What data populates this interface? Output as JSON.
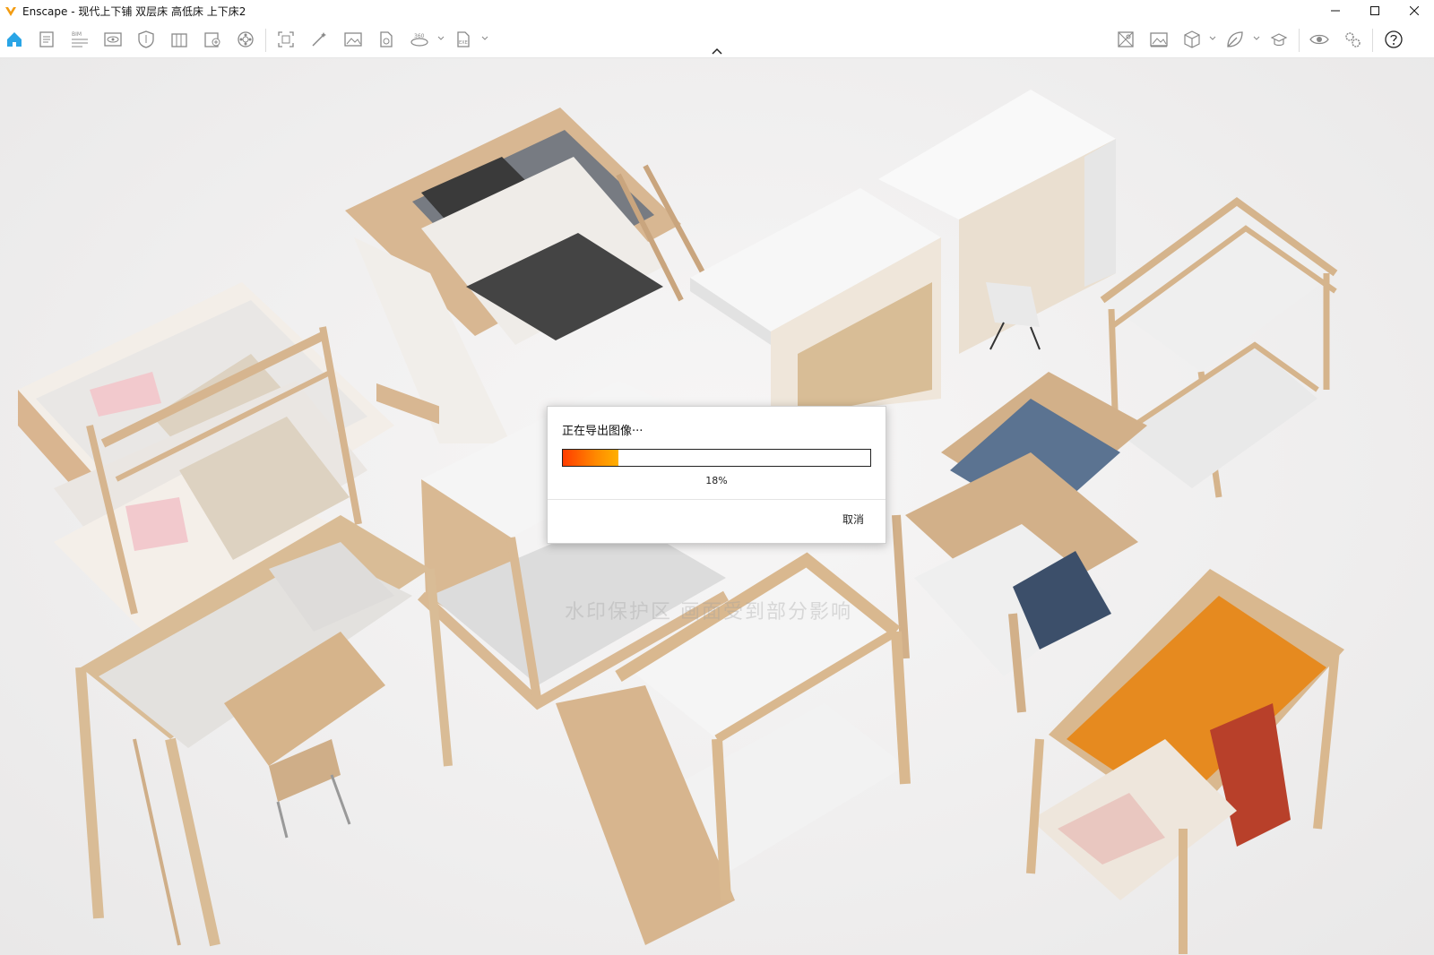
{
  "window": {
    "title": "Enscape - 现代上下铺 双层床 高低床 上下床2",
    "controls": [
      "minimize-icon",
      "maximize-icon",
      "close-icon"
    ]
  },
  "toolbar": {
    "left_icons": [
      "home-icon",
      "document-icon",
      "bim-icon",
      "eye-view-icon",
      "shield-icon",
      "library-icon",
      "export-doc-icon",
      "settings-wheel-icon",
      "screenshot-icon",
      "magic-wand-icon",
      "image-icon",
      "file-icon",
      "panorama-360-icon",
      "exe-export-icon"
    ],
    "right_icons": [
      "map-icon",
      "gallery-icon",
      "cube-icon",
      "leaf-icon",
      "hat-icon",
      "eye-icon",
      "gear-icon",
      "help-icon"
    ],
    "bim_label": "BIM",
    "pano_label": "360",
    "exe_label": "EXE"
  },
  "scene": {
    "watermark": "水印保护区 画面受到部分影响",
    "accent_color": "#ff6a00"
  },
  "dialog": {
    "title": "正在导出图像···",
    "progress": 0.18,
    "progress_text": "18%",
    "cancel_label": "取消"
  }
}
